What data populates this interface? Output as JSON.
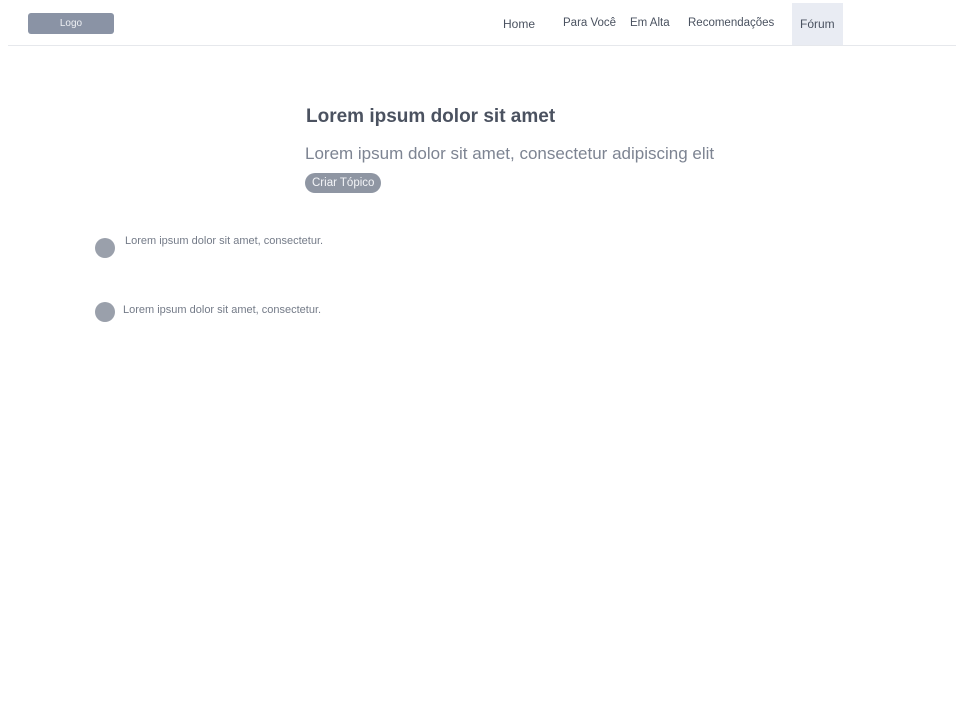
{
  "header": {
    "logo": "Logo",
    "nav": [
      {
        "label": "Home"
      },
      {
        "label": "Para Você"
      },
      {
        "label": "Em Alta"
      },
      {
        "label": "Recomendações"
      },
      {
        "label": "Fórum",
        "active": true
      }
    ]
  },
  "hero": {
    "title": "Lorem ipsum dolor sit amet",
    "subtitle": "Lorem ipsum dolor sit amet, consectetur adipiscing elit",
    "cta_label": "Criar Tópico"
  },
  "topics": [
    {
      "text": "Lorem ipsum dolor sit amet, consectetur."
    },
    {
      "text": "Lorem ipsum dolor sit amet, consectetur."
    }
  ],
  "colors": {
    "logo_bg": "#8a93a5",
    "active_nav_bg": "#e9ecf3",
    "button_bg": "#8f96a3",
    "avatar_bg": "#9aa0ab"
  }
}
